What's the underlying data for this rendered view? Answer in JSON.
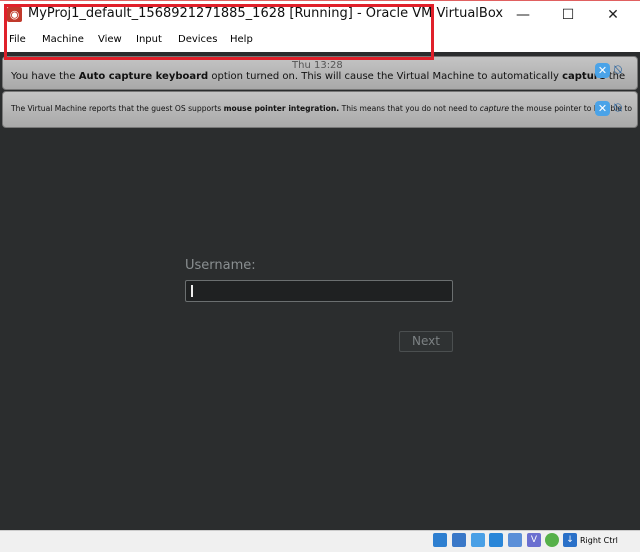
{
  "window": {
    "title": "MyProj1_default_1568921271885_1628 [Running] - Oracle VM VirtualBox",
    "minimize": "—",
    "maximize": "☐",
    "close": "✕"
  },
  "menu": [
    "File",
    "Machine",
    "View",
    "Input",
    "Devices",
    "Help"
  ],
  "guest": {
    "clock": "Thu 13:28",
    "username_label": "Username:",
    "username_value": "",
    "next_label": "Next"
  },
  "banners": {
    "keyboard": {
      "pre": "You have the ",
      "bold1": "Auto capture keyboard",
      "mid": " option turned on. This will cause the Virtual Machine to automatically ",
      "bold2": "capture",
      "post": " the"
    },
    "mouse": {
      "pre": "The Virtual Machine reports that the guest OS supports ",
      "bold1": "mouse pointer integration.",
      "mid": " This means that you do not need to ",
      "ital": "capture",
      "post": " the mouse pointer to be able to"
    }
  },
  "statusbar": {
    "icons": [
      "optical-drive-icon",
      "network-icon",
      "shared-folders-icon",
      "display-icon",
      "video-capture-icon",
      "vt-x-icon",
      "mouse-integration-icon",
      "keyboard-capture-icon"
    ],
    "host_key": "Right Ctrl"
  },
  "colors": {
    "highlight": "#e0202a",
    "vm_bg": "#2b2d2e",
    "close_x": "#4aa3e8"
  }
}
